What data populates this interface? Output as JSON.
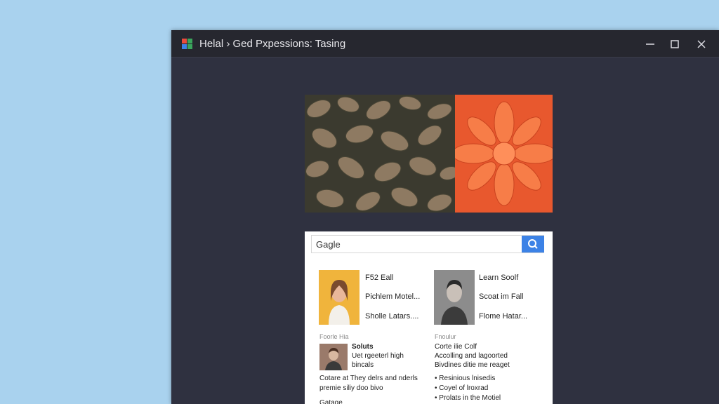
{
  "window": {
    "title": "Helal › Ged Pxpessions: Tasing",
    "icon": "grid-app-icon",
    "controls": [
      "minimize-icon",
      "maximize-icon",
      "close-icon"
    ]
  },
  "hero": {
    "left_image": "leaf-image",
    "right_image": "orange-flower-image"
  },
  "search": {
    "value": "Gagle",
    "button_icon": "search-icon",
    "button_color": "#3c82e6"
  },
  "results": {
    "left_items": [
      "F52 Eall",
      "Pichlem Motel...",
      "Sholle Latars...."
    ],
    "right_items": [
      "Learn Soolf",
      "Scoat im Fall",
      "Flome Hatar..."
    ],
    "left_section": {
      "heading": "Foorle Hia",
      "line1": "Soluts",
      "line2": "Uet rgeeterl high",
      "line3": "bincals",
      "para1": "Cotare at They delrs and nderls",
      "para2": "premie siliy doo bivo",
      "footer": "Gatage"
    },
    "right_section": {
      "heading": "Fnoulur",
      "line1": "Corte ilie Colf",
      "line2": "Accolling and lagoorted",
      "line3": "Bivdines ditie me reaget",
      "bullets": [
        "Resinious lnisedis",
        "Coyel of lroxrad",
        "Prolats in the Motiel"
      ]
    }
  },
  "colors": {
    "desktop": "#a9d2ee",
    "window_bg": "#2f3140",
    "titlebar": "#26272f"
  }
}
